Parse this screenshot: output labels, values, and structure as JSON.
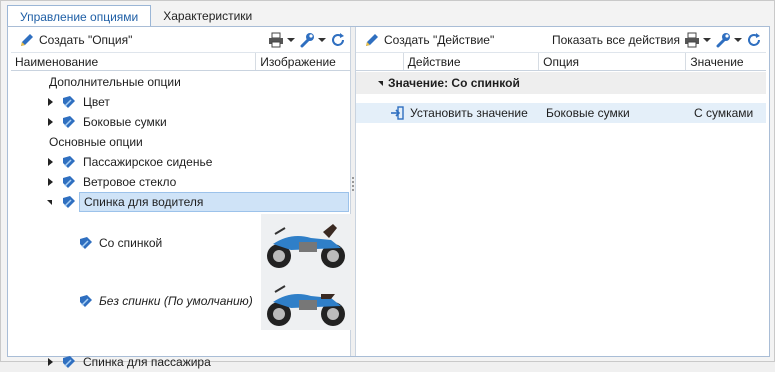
{
  "tabs": [
    {
      "label": "Управление опциями",
      "active": true
    },
    {
      "label": "Характеристики",
      "active": false
    }
  ],
  "left": {
    "create_button": "Создать \"Опция\"",
    "columns": [
      "Наименование",
      "Изображение"
    ],
    "tree": {
      "group_additional": "Дополнительные опции",
      "item_color": "Цвет",
      "item_sidebags": "Боковые сумки",
      "group_basic": "Основные опции",
      "item_passenger_seat": "Пассажирское сиденье",
      "item_windshield": "Ветровое стекло",
      "item_driver_backrest": "Спинка для водителя",
      "value_with_backrest": "Со спинкой",
      "value_without_backrest": "Без спинки (По умолчанию)",
      "item_passenger_backrest": "Спинка для пассажира"
    }
  },
  "right": {
    "create_button": "Создать \"Действие\"",
    "show_all_button": "Показать все действия",
    "columns": [
      "Действие",
      "Опция",
      "Значение"
    ],
    "group_label": "Значение: Со спинкой",
    "row": {
      "action": "Установить значение",
      "option": "Боковые сумки",
      "value": "С сумками"
    }
  },
  "colors": {
    "accent": "#1f5fa6",
    "selection": "#cfe3f7",
    "icon_blue": "#2f6fc0"
  }
}
